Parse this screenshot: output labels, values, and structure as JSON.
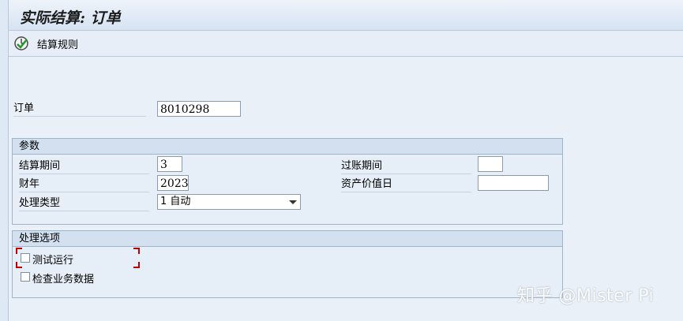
{
  "window": {
    "title": "实际结算: 订单"
  },
  "toolbar": {
    "settlement_rule_label": "结算规则",
    "settlement_rule_icon": "execute-clock-icon"
  },
  "order": {
    "label": "订单",
    "value": "8010298"
  },
  "params": {
    "header": "参数",
    "settlement_period_label": "结算期间",
    "settlement_period_value": "3",
    "posting_period_label": "过账期间",
    "posting_period_value": "",
    "fiscal_year_label": "财年",
    "fiscal_year_value": "2023",
    "asset_value_date_label": "资产价值日",
    "asset_value_date_value": "",
    "processing_type_label": "处理类型",
    "processing_type_value": "1 自动"
  },
  "options": {
    "header": "处理选项",
    "test_run_label": "测试运行",
    "check_business_data_label": "检查业务数据"
  },
  "watermark": "知乎 @Mister Pi"
}
